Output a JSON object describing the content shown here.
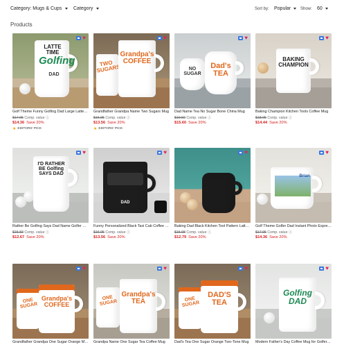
{
  "filters": {
    "category_filter": "Category: Mugs & Cups",
    "category": "Category",
    "sort_label": "Sort by:",
    "sort_value": "Popular",
    "show_label": "Show:",
    "show_value": "60"
  },
  "section_title": "Products",
  "products": [
    {
      "title": "Golf Theme Funny Golfing Dad Large Latte Mug",
      "old": "$17.95",
      "comp": "Comp. value",
      "price": "$14.36",
      "save": "Save 20%",
      "pick": "EDITORS' PICK",
      "mugtext": "LATTE TIME"
    },
    {
      "title": "Grandfather Grandpa Name Two Sugars Mug",
      "old": "$16.95",
      "comp": "Comp. value",
      "price": "$13.56",
      "save": "Save 20%",
      "pick": "EDITORS' PICK",
      "mugtext": "Grandpa's COFFEE"
    },
    {
      "title": "Dad Name Tea No Sugar Bone China Mug",
      "old": "$19.50",
      "comp": "Comp. value",
      "price": "$15.60",
      "save": "Save 20%",
      "mugtext": "Dad's TEA"
    },
    {
      "title": "Baking Champion Kitchen Tools Coffee Mug",
      "old": "$18.05",
      "comp": "Comp. value",
      "price": "$14.44",
      "save": "Save 20%",
      "mugtext": "BAKING CHAMPION"
    },
    {
      "title": "Rather Be Golfing Says Dad Name Golfer Mug",
      "old": "$15.83",
      "comp": "Comp. value",
      "price": "$12.67",
      "save": "Save 20%",
      "mugtext": "I'D RATHER BE Golfing SAYS DAD"
    },
    {
      "title": "Funny Personalized Black Taxi Cab Coffee Mug",
      "old": "$16.95",
      "comp": "Comp. value",
      "price": "$13.56",
      "save": "Save 20%",
      "mugtext": "DAD"
    },
    {
      "title": "Baking Dad Black Kitchen Tool Pattern Latte Mug",
      "old": "$15.98",
      "comp": "Comp. value",
      "price": "$12.79",
      "save": "Save 20%",
      "mugtext": ""
    },
    {
      "title": "Golf Theme Golfer Dad Instant Photo Espresso Mug",
      "old": "$17.95",
      "comp": "Comp. value",
      "price": "$14.36",
      "save": "Save 20%",
      "mugtext": "Brian"
    },
    {
      "title": "Grandfather Grandpa One Sugar Orange Mug",
      "old": "",
      "comp": "",
      "price": "",
      "save": "",
      "mugtext": "Grandpa's COFFEE"
    },
    {
      "title": "Grandpa Name One Sugar Tea Coffee Mug",
      "old": "",
      "comp": "",
      "price": "",
      "save": "",
      "mugtext": "Grandpa's TEA"
    },
    {
      "title": "Dad's Tea One Sugar Orange Two-Tone Mug",
      "old": "",
      "comp": "",
      "price": "",
      "save": "",
      "mugtext": "DAD'S TEA"
    },
    {
      "title": "Modern Father's Day Coffee Mug for Golfer Dad",
      "old": "",
      "comp": "",
      "price": "",
      "save": "",
      "mugtext": "Golfing DAD"
    }
  ],
  "colors": {
    "accent_red": "#d51c1c",
    "badge_blue": "#3a78e0",
    "heart_pink": "#e0245e"
  }
}
